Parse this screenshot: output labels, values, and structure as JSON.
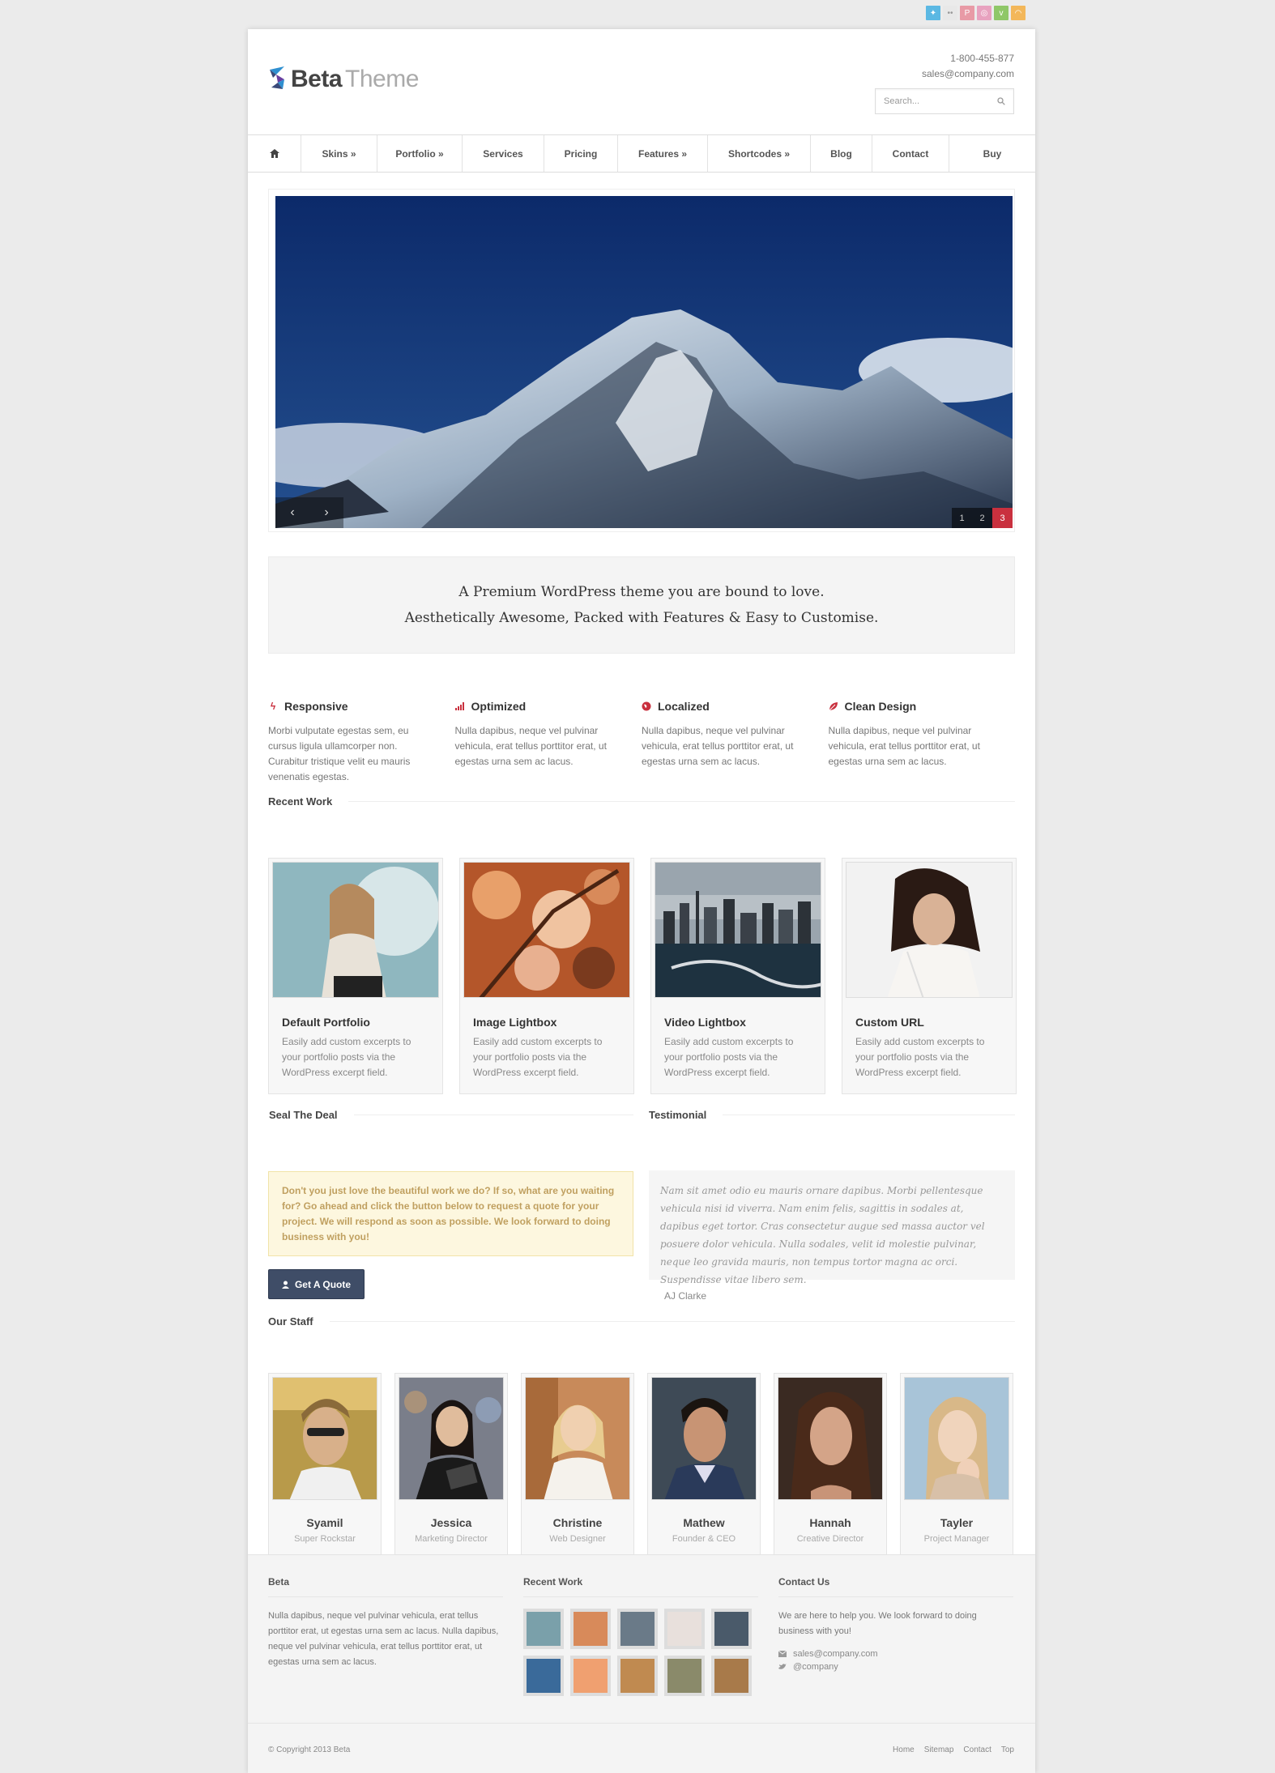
{
  "social": [
    "twitter-icon",
    "flickr-icon",
    "pinterest-icon",
    "dribbble-icon",
    "vimeo-icon",
    "rss-icon"
  ],
  "colors": {
    "accent": "#c9303e",
    "button": "#3f4d67",
    "notice_bg": "#fdf7df"
  },
  "header": {
    "logo_bold": "Beta",
    "logo_light": "Theme",
    "phone": "1-800-455-877",
    "email": "sales@company.com",
    "search_placeholder": "Search..."
  },
  "nav": [
    "Skins »",
    "Portfolio »",
    "Services",
    "Pricing",
    "Features »",
    "Shortcodes »",
    "Blog",
    "Contact",
    "Buy"
  ],
  "slider": {
    "prev": "‹",
    "next": "›",
    "pages": [
      "1",
      "2",
      "3"
    ],
    "active_page": "3"
  },
  "tagline": {
    "line1": "A Premium WordPress theme you are bound to love.",
    "line2": "Aesthetically Awesome, Packed with Features & Easy to Customise."
  },
  "features": [
    {
      "title": "Responsive",
      "icon": "bolt-icon",
      "text": "Morbi vulputate egestas sem, eu cursus ligula ullamcorper non. Curabitur tristique velit eu mauris venenatis egestas."
    },
    {
      "title": "Optimized",
      "icon": "signal-icon",
      "text": "Nulla dapibus, neque vel pulvinar vehicula, erat tellus porttitor erat, ut egestas urna sem ac lacus."
    },
    {
      "title": "Localized",
      "icon": "globe-icon",
      "text": "Nulla dapibus, neque vel pulvinar vehicula, erat tellus porttitor erat, ut egestas urna sem ac lacus."
    },
    {
      "title": "Clean Design",
      "icon": "leaf-icon",
      "text": "Nulla dapibus, neque vel pulvinar vehicula, erat tellus porttitor erat, ut egestas urna sem ac lacus."
    }
  ],
  "recent_work": {
    "heading": "Recent Work",
    "items": [
      {
        "title": "Default Portfolio",
        "text": "Easily add custom excerpts to your portfolio posts via the WordPress excerpt field."
      },
      {
        "title": "Image Lightbox",
        "text": "Easily add custom excerpts to your portfolio posts via the WordPress excerpt field."
      },
      {
        "title": "Video Lightbox",
        "text": "Easily add custom excerpts to your portfolio posts via the WordPress excerpt field."
      },
      {
        "title": "Custom URL",
        "text": "Easily add custom excerpts to your portfolio posts via the WordPress excerpt field."
      }
    ]
  },
  "seal": {
    "heading": "Seal The Deal",
    "text": "Don't you just love the beautiful work we do? If so, what are you waiting for? Go ahead and click the button below to request a quote for your project. We will respond as soon as possible. We look forward to doing business with you!",
    "button": "Get A Quote"
  },
  "testimonial": {
    "heading": "Testimonial",
    "text": "Nam sit amet odio eu mauris ornare dapibus. Morbi pellentesque vehicula nisi id viverra. Nam enim felis, sagittis in sodales at, dapibus eget tortor. Cras consectetur augue sed massa auctor vel posuere dolor vehicula. Nulla sodales, velit id molestie pulvinar, neque leo gravida mauris, non tempus tortor magna ac orci. Suspendisse vitae libero sem.",
    "author": "AJ Clarke"
  },
  "staff": {
    "heading": "Our Staff",
    "members": [
      {
        "name": "Syamil",
        "role": "Super Rockstar"
      },
      {
        "name": "Jessica",
        "role": "Marketing Director"
      },
      {
        "name": "Christine",
        "role": "Web Designer"
      },
      {
        "name": "Mathew",
        "role": "Founder & CEO"
      },
      {
        "name": "Hannah",
        "role": "Creative Director"
      },
      {
        "name": "Tayler",
        "role": "Project Manager"
      }
    ]
  },
  "footer": {
    "about_heading": "Beta",
    "about_text": "Nulla dapibus, neque vel pulvinar vehicula, erat tellus porttitor erat, ut egestas urna sem ac lacus. Nulla dapibus, neque vel pulvinar vehicula, erat tellus porttitor erat, ut egestas urna sem ac lacus.",
    "work_heading": "Recent Work",
    "contact_heading": "Contact Us",
    "contact_text": "We are here to help you. We look forward to doing business with you!",
    "contact_email": "sales@company.com",
    "contact_twitter": "@company",
    "copyright_prefix": "© Copyright 2013",
    "copyright_name": "Beta",
    "links": [
      "Home",
      "Sitemap",
      "Contact",
      "Top"
    ]
  }
}
